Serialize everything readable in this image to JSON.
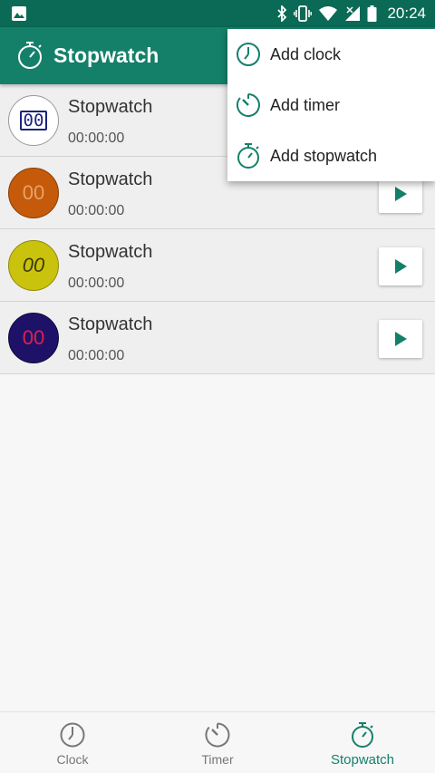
{
  "status_bar": {
    "time": "20:24",
    "left_icon": "image-icon",
    "right_icons": [
      "bluetooth-icon",
      "vibrate-icon",
      "wifi-icon",
      "signal-icon",
      "battery-icon"
    ]
  },
  "app_bar": {
    "title": "Stopwatch",
    "icon": "stopwatch-icon"
  },
  "stopwatches": [
    {
      "name": "Stopwatch",
      "elapsed": "00:00:00",
      "face": "00",
      "style": "white"
    },
    {
      "name": "Stopwatch",
      "elapsed": "00:00:00",
      "face": "00",
      "style": "orange"
    },
    {
      "name": "Stopwatch",
      "elapsed": "00:00:00",
      "face": "00",
      "style": "yellow"
    },
    {
      "name": "Stopwatch",
      "elapsed": "00:00:00",
      "face": "00",
      "style": "navy"
    }
  ],
  "menu": {
    "items": [
      {
        "label": "Add clock",
        "icon": "clock-icon"
      },
      {
        "label": "Add timer",
        "icon": "timer-icon"
      },
      {
        "label": "Add stopwatch",
        "icon": "stopwatch-icon"
      }
    ]
  },
  "bottom_nav": {
    "items": [
      {
        "label": "Clock",
        "icon": "clock-icon",
        "active": false
      },
      {
        "label": "Timer",
        "icon": "timer-icon",
        "active": false
      },
      {
        "label": "Stopwatch",
        "icon": "stopwatch-icon",
        "active": true
      }
    ]
  },
  "colors": {
    "status_bar": "#0a6a55",
    "app_bar": "#14806a",
    "accent": "#14806a",
    "play_icon": "#14806a"
  }
}
